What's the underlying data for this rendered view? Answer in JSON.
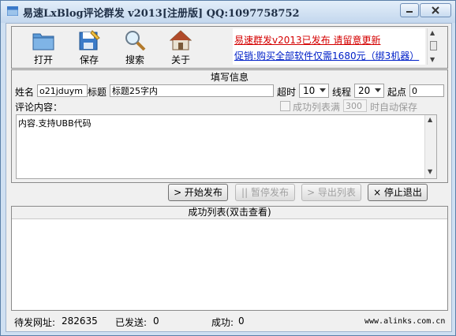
{
  "window": {
    "title": "易速LxBlog评论群发 v2013[注册版] QQ:1097758752"
  },
  "toolbar": {
    "open": "打开",
    "save": "保存",
    "search": "搜索",
    "about": "关于"
  },
  "promo": {
    "line1": "易速群发v2013已发布 请留意更新",
    "line2": "促销:购买全部软件仅需1680元（绑3机器）"
  },
  "form": {
    "section_title": "填写信息",
    "name_label": "姓名",
    "name_value": "o21jduym",
    "title_label": "标题",
    "title_value": "标题25字内",
    "timeout_label": "超时",
    "timeout_value": "10",
    "threads_label": "线程",
    "threads_value": "20",
    "start_label": "起点",
    "start_value": "0",
    "comment_label": "评论内容：",
    "success_list_full_label": "成功列表满",
    "autosave_value": "300",
    "autosave_suffix": "时自动保存",
    "comment_text": "内容.支持UBB代码"
  },
  "buttons": {
    "start": "> 开始发布",
    "pause": "|| 暂停发布",
    "export": "> 导出列表",
    "stop": "× 停止退出"
  },
  "list": {
    "title": "成功列表(双击查看)"
  },
  "status": {
    "pending_label": "待发网址:",
    "pending_value": "282635",
    "sent_label": "已发送:",
    "sent_value": "0",
    "success_label": "成功:",
    "success_value": "0",
    "site": "www.alinks.com.cn"
  },
  "colors": {
    "promo_red": "#d40000",
    "promo_blue": "#0020c8"
  }
}
